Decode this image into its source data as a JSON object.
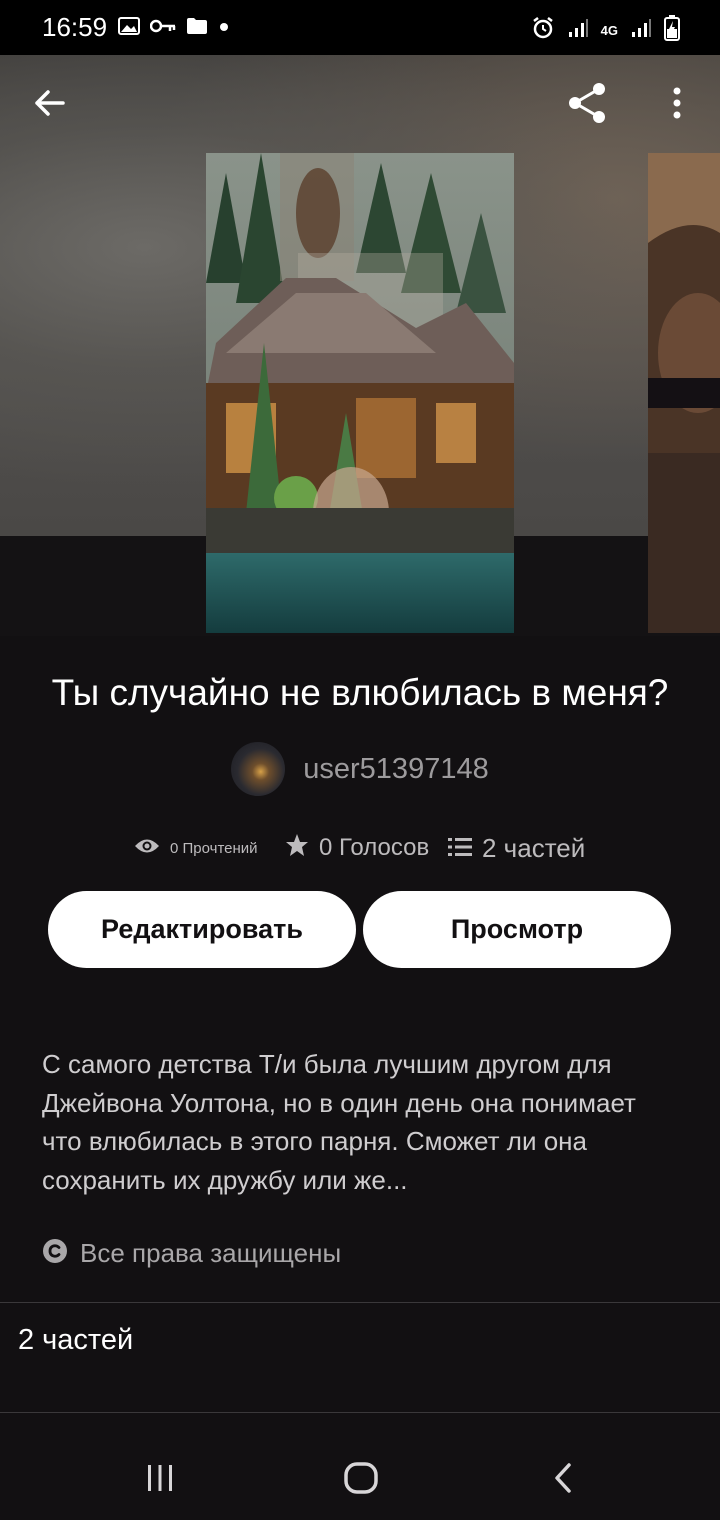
{
  "status_bar": {
    "time": "16:59",
    "left_icons": [
      "image-icon",
      "key-icon",
      "folder-icon",
      "dot-icon"
    ],
    "right_icons": [
      "alarm-icon",
      "signal-icon",
      "network-4g-icon",
      "signal-icon",
      "battery-charging-icon"
    ],
    "network_label": "4G"
  },
  "header": {
    "back_icon": "arrow-left-icon",
    "share_icon": "share-icon",
    "more_icon": "more-vertical-icon"
  },
  "story": {
    "title": "Ты случайно не влюбилась в меня?",
    "author": "user51397148",
    "stats": {
      "reads": "0 Прочтений",
      "votes": "0 Голосов",
      "parts": "2 частей"
    },
    "description": "С самого детства Т/и была лучшим другом для Джейвона Уолтона, но в один день она понимает что влюбилась в этого парня. Сможет ли она сохранить их дружбу или же...",
    "copyright": "Все права защищены"
  },
  "actions": {
    "edit_label": "Редактировать",
    "view_label": "Просмотр"
  },
  "parts_section": {
    "header": "2 частей"
  },
  "nav": {
    "recents_icon": "recents-icon",
    "home_icon": "home-icon",
    "back_icon": "back-chevron-icon"
  },
  "colors": {
    "background": "#121012",
    "button_bg": "#ffffff",
    "muted_text": "#9d9b9d"
  }
}
